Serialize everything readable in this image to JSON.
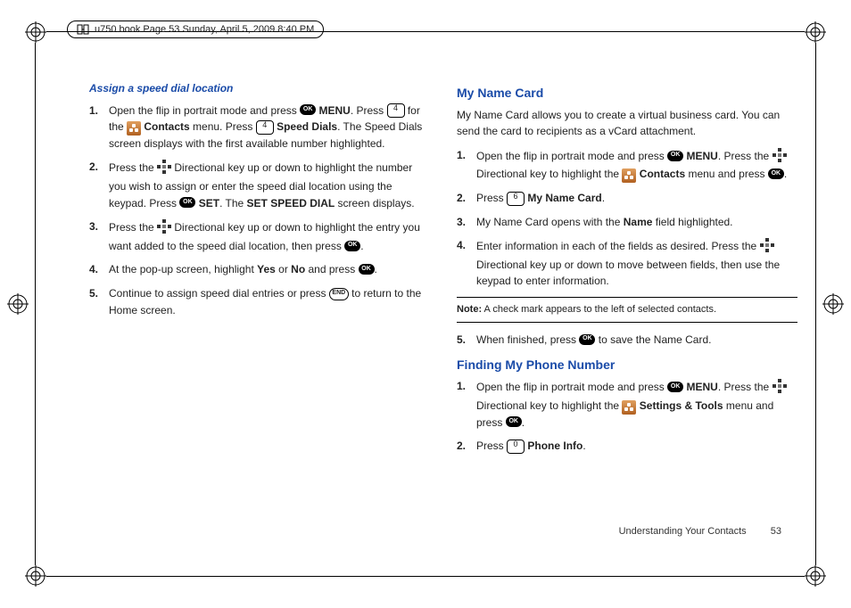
{
  "header": {
    "text": "u750.book  Page 53  Sunday, April 5, 2009  8:40 PM"
  },
  "left": {
    "title": "Assign a speed dial location",
    "s1a": "Open the flip in portrait mode and press ",
    "s1b": " MENU",
    "s1c": ". Press ",
    "s1d": " for the ",
    "s1e": " Contacts",
    "s1f": " menu. Press ",
    "s1g": " Speed Dials",
    "s1h": ". The Speed Dials screen displays with the first available number highlighted.",
    "key4": "4",
    "s2a": "Press the ",
    "s2b": " Directional key up or down to highlight the number you wish to assign or enter the speed dial location using the keypad. Press ",
    "s2c": " SET",
    "s2d": ". The ",
    "s2e": "SET SPEED DIAL",
    "s2f": " screen displays.",
    "s3a": "Press the ",
    "s3b": " Directional key up or down to highlight the entry you want added to the speed dial location, then press ",
    "s3c": ".",
    "s4a": "At the pop-up screen, highlight ",
    "s4b": "Yes",
    "s4c": " or ",
    "s4d": "No",
    "s4e": " and press ",
    "s4f": ".",
    "s5a": "Continue to assign speed dial entries or press ",
    "s5b": " to return to the Home screen.",
    "n1": "1.",
    "n2": "2.",
    "n3": "3.",
    "n4": "4.",
    "n5": "5."
  },
  "right": {
    "title1": "My Name Card",
    "intro": "My Name Card allows you to create a virtual business card. You can send the card to recipients as a vCard attachment.",
    "s1a": "Open the flip in portrait mode and press ",
    "s1b": " MENU",
    "s1c": ". Press the ",
    "s1d": " Directional key to highlight the ",
    "s1e": " Contacts",
    "s1f": " menu and press ",
    "s1g": ".",
    "s2a": " Press ",
    "s2b": " My Name Card",
    "s2c": ".",
    "key6": "6",
    "s3a": "My Name Card opens with the ",
    "s3b": "Name",
    "s3c": " field highlighted.",
    "s4a": "Enter information in each of the fields as desired. Press the ",
    "s4b": " Directional key up or down to move between fields, then use the keypad to enter information.",
    "noteLabel": "Note:",
    "noteText": " A check mark appears to the left of selected contacts.",
    "s5a": "When finished, press ",
    "s5b": " to save the Name Card.",
    "title2": "Finding My Phone Number",
    "f1a": "Open the flip in portrait mode and press ",
    "f1b": " MENU",
    "f1c": ". Press the ",
    "f1d": " Directional key to highlight the ",
    "f1e": " Settings & Tools",
    "f1f": " menu and press ",
    "f1g": ".",
    "f2a": "Press ",
    "f2b": " Phone Info",
    "f2c": ".",
    "key0": "0",
    "n1": "1.",
    "n2": "2.",
    "n3": "3.",
    "n4": "4.",
    "n5": "5."
  },
  "footer": {
    "section": "Understanding Your Contacts",
    "page": "53"
  },
  "ok": "OK",
  "end": "END"
}
